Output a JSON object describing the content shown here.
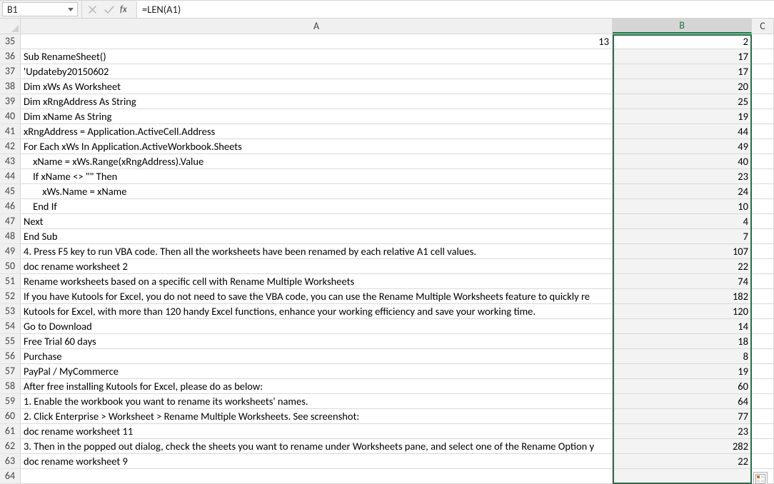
{
  "name_box": "B1",
  "formula": "=LEN(A1)",
  "columns": [
    "A",
    "B",
    "C"
  ],
  "selected_column": "B",
  "first_row_num": 35,
  "rows": [
    {
      "a": 13,
      "a_num": true,
      "b": 2
    },
    {
      "a": "Sub RenameSheet()",
      "b": 17
    },
    {
      "a": "'Updateby20150602",
      "b": 17
    },
    {
      "a": "Dim xWs As Worksheet",
      "b": 20
    },
    {
      "a": "Dim xRngAddress As String",
      "b": 25
    },
    {
      "a": "Dim xName As String",
      "b": 19
    },
    {
      "a": "xRngAddress = Application.ActiveCell.Address",
      "b": 44
    },
    {
      "a": "For Each xWs In Application.ActiveWorkbook.Sheets",
      "b": 49
    },
    {
      "a": "    xName = xWs.Range(xRngAddress).Value",
      "b": 40
    },
    {
      "a": "    If xName <> \"\" Then",
      "b": 23
    },
    {
      "a": "        xWs.Name = xName",
      "b": 24
    },
    {
      "a": "    End If",
      "b": 10
    },
    {
      "a": "Next",
      "b": 4
    },
    {
      "a": "End Sub",
      "b": 7
    },
    {
      "a": "4. Press F5 key to run VBA code. Then all the worksheets have been renamed by each relative A1 cell values.",
      "b": 107
    },
    {
      "a": "doc rename worksheet 2",
      "b": 22
    },
    {
      "a": "Rename worksheets based on a specific cell with Rename Multiple Worksheets",
      "b": 74
    },
    {
      "a": "If you have Kutools for Excel, you do not need to save the VBA code, you can use the Rename Multiple Worksheets feature to quickly re",
      "b": 182
    },
    {
      "a": "Kutools for Excel, with more than 120 handy Excel functions, enhance your working efficiency and save your working time.",
      "b": 120
    },
    {
      "a": "Go to Download",
      "b": 14
    },
    {
      "a": "Free Trial 60 days",
      "b": 18
    },
    {
      "a": "Purchase",
      "b": 8
    },
    {
      "a": "PayPal / MyCommerce",
      "b": 19
    },
    {
      "a": "After free installing Kutools for Excel, please do as below:",
      "b": 60
    },
    {
      "a": "1. Enable the workbook you want to rename its worksheets' names.",
      "b": 64
    },
    {
      "a": "2. Click Enterprise > Worksheet > Rename Multiple Worksheets. See screenshot:",
      "b": 77
    },
    {
      "a": "doc rename worksheet 11",
      "b": 23
    },
    {
      "a": "3. Then in the popped out dialog, check the sheets you want to rename under Worksheets pane, and select one of the Rename Option y",
      "b": 282
    },
    {
      "a": "doc rename worksheet 9",
      "b": 22
    },
    {
      "a": "",
      "b": ""
    }
  ]
}
